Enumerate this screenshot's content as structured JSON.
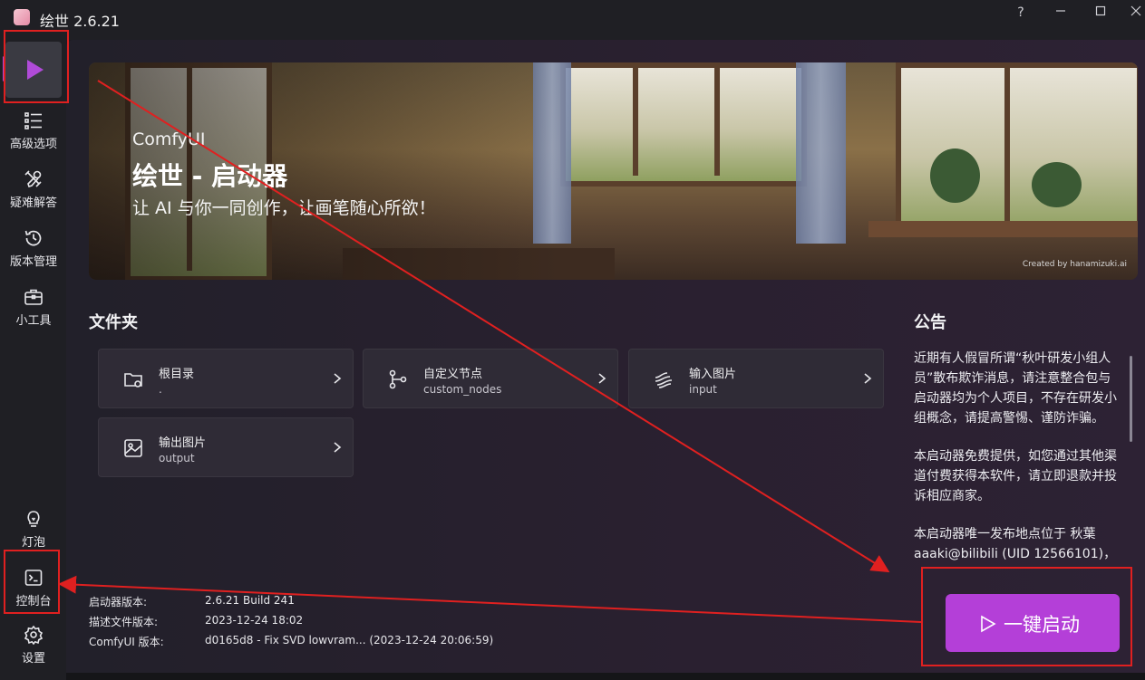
{
  "window": {
    "title": "绘世 2.6.21",
    "help": "?",
    "minimize": "—",
    "maximize": "□",
    "close": "✕"
  },
  "sidebar": {
    "items": [
      {
        "label": "高级选项",
        "icon": "list-icon"
      },
      {
        "label": "疑难解答",
        "icon": "wrench-icon"
      },
      {
        "label": "版本管理",
        "icon": "history-icon"
      },
      {
        "label": "小工具",
        "icon": "toolbox-icon"
      }
    ],
    "bottom": [
      {
        "label": "灯泡",
        "icon": "lightbulb-icon"
      },
      {
        "label": "控制台",
        "icon": "terminal-icon"
      },
      {
        "label": "设置",
        "icon": "gear-icon"
      }
    ]
  },
  "banner": {
    "subtitle": "ComfyUI",
    "title": "绘世 - 启动器",
    "slogan": "让 AI 与你一同创作，让画笔随心所欲！",
    "credit": "Created by hanamizuki.ai"
  },
  "folders": {
    "title": "文件夹",
    "items": [
      {
        "label": "根目录",
        "value": "."
      },
      {
        "label": "自定义节点",
        "value": "custom_nodes"
      },
      {
        "label": "输入图片",
        "value": "input"
      },
      {
        "label": "输出图片",
        "value": "output"
      }
    ]
  },
  "notice": {
    "title": "公告",
    "paragraphs": [
      "近期有人假冒所谓“秋叶研发小组人员”散布欺诈消息，请注意整合包与启动器均为个人项目，不存在研发小组概念，请提高警惕、谨防诈骗。",
      "本启动器免费提供，如您通过其他渠道付费获得本软件，请立即退款并投诉相应商家。",
      "本启动器唯一发布地点位于 秋葉aaaki@bilibili (UID 12566101)，"
    ]
  },
  "info": {
    "launcher_version_label": "启动器版本:",
    "launcher_version": "2.6.21 Build 241",
    "desc_version_label": "描述文件版本:",
    "desc_version": "2023-12-24 18:02",
    "comfyui_version_label": "ComfyUI 版本:",
    "comfyui_version": "d0165d8 - Fix SVD lowvram... (2023-12-24 20:06:59)"
  },
  "launch_button": {
    "label": "一键启动"
  },
  "colors": {
    "accent": "#b43fd8",
    "annotation": "#e02020"
  }
}
